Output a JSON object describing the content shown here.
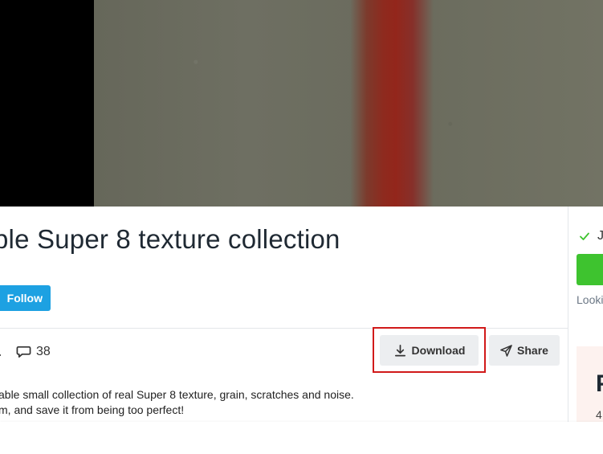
{
  "post": {
    "title": "ble Super 8 texture collection",
    "follow_label": "Follow",
    "comment_count": "38",
    "description_line1": "able small collection of real Super 8 texture, grain, scratches and noise.",
    "description_line2": "m, and save it from being too perfect!"
  },
  "actions": {
    "download_label": "Download",
    "share_label": "Share"
  },
  "sidebar": {
    "check_text": "J",
    "looking_text": "Looki",
    "card_letter": "P",
    "card_number": "4"
  },
  "colors": {
    "follow_bg": "#1da1e2",
    "highlight": "#d11a1a",
    "green": "#3ec32f",
    "button_bg": "#eceef0"
  }
}
